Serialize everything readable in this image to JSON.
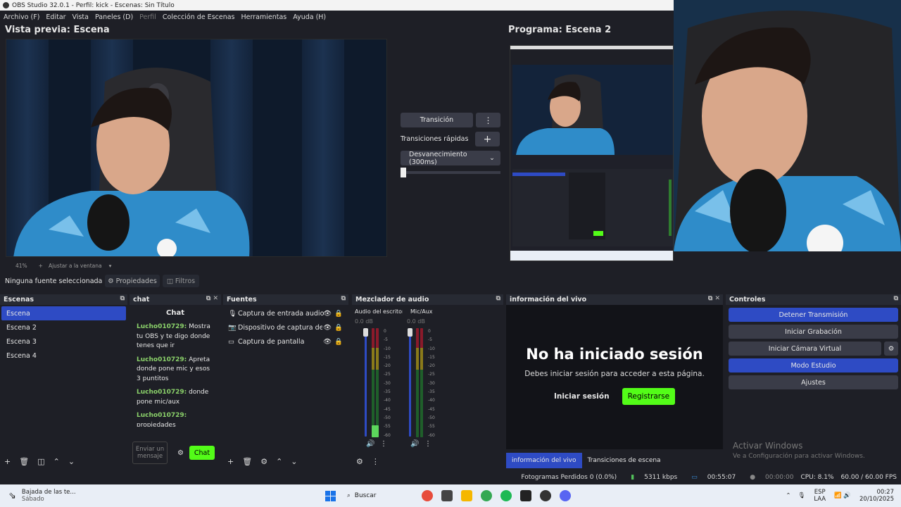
{
  "window": {
    "title": "OBS Studio 32.0.1 - Perfil: kick - Escenas: Sin Título"
  },
  "menu": [
    "Archivo (F)",
    "Editar",
    "Vista",
    "Paneles (D)",
    "Perfil",
    "Colección de Escenas",
    "Herramientas",
    "Ayuda (H)"
  ],
  "preview": {
    "label": "Vista previa: Escena",
    "zoom": "41%",
    "fit": "Ajustar a la ventana"
  },
  "program": {
    "label": "Programa: Escena 2"
  },
  "transitions": {
    "button": "Transición",
    "quick_label": "Transiciones rápidas",
    "selected": "Desvanecimiento (300ms)"
  },
  "source_toolbar": {
    "none_selected": "Ninguna fuente seleccionada",
    "properties": "Propiedades",
    "filters": "Filtros"
  },
  "scenes": {
    "title": "Escenas",
    "items": [
      "Escena",
      "Escena 2",
      "Escena 3",
      "Escena 4"
    ]
  },
  "chat": {
    "title": "chat",
    "header": "Chat",
    "messages": [
      {
        "user": "Lucho010729:",
        "text": "Mostra tu OBS y te digo donde tenes que ir"
      },
      {
        "user": "Lucho010729:",
        "text": "Apreta donde pone mic y esos 3 puntitos"
      },
      {
        "user": "Lucho010729:",
        "text": "donde pone mic/aux"
      },
      {
        "user": "Lucho010729:",
        "text": "propiedades"
      }
    ],
    "input_placeholder": "Enviar un mensaje",
    "send": "Chat"
  },
  "sources": {
    "title": "Fuentes",
    "items": [
      "Captura de entrada audio",
      "Dispositivo de captura de vide",
      "Captura de pantalla"
    ]
  },
  "mixer": {
    "title": "Mezclador de audio",
    "channels": [
      {
        "name": "Audio del escritorio",
        "db": "0.0 dB",
        "level": 0.1
      },
      {
        "name": "Mic/Aux",
        "db": "0.0 dB",
        "level": 0.0
      }
    ],
    "scale": [
      "0",
      "-5",
      "-10",
      "-15",
      "-20",
      "-25",
      "-30",
      "-35",
      "-40",
      "-45",
      "-50",
      "-55",
      "-60"
    ]
  },
  "live_info": {
    "title": "información del vivo",
    "heading": "No ha iniciado sesión",
    "subtitle": "Debes iniciar sesión para acceder a esta página.",
    "login": "Iniciar sesión",
    "register": "Registrarse",
    "tab_active": "información del vivo",
    "tab_other": "Transiciones de escena"
  },
  "controls": {
    "title": "Controles",
    "buttons": [
      "Detener Transmisión",
      "Iniciar Grabación",
      "Iniciar Cámara Virtual",
      "Modo Estudio",
      "Ajustes"
    ]
  },
  "watermark": {
    "line1": "Activar Windows",
    "line2": "Ve a Configuración para activar Windows."
  },
  "status": {
    "dropped": "Fotogramas Perdidos 0 (0.0%)",
    "bitrate": "5311 kbps",
    "stream_time": "00:55:07",
    "rec_time": "00:00:00",
    "cpu": "CPU: 8.1%",
    "fps": "60.00 / 60.00 FPS"
  },
  "taskbar": {
    "weather_title": "Bajada de las te...",
    "weather_sub": "Sábado",
    "search": "Buscar",
    "lang1": "ESP",
    "lang2": "LAA",
    "time": "00:27",
    "date": "20/10/2025"
  },
  "colors": {
    "accent": "#2e4bc4",
    "green": "#53fc18",
    "bg": "#1e1f26"
  }
}
